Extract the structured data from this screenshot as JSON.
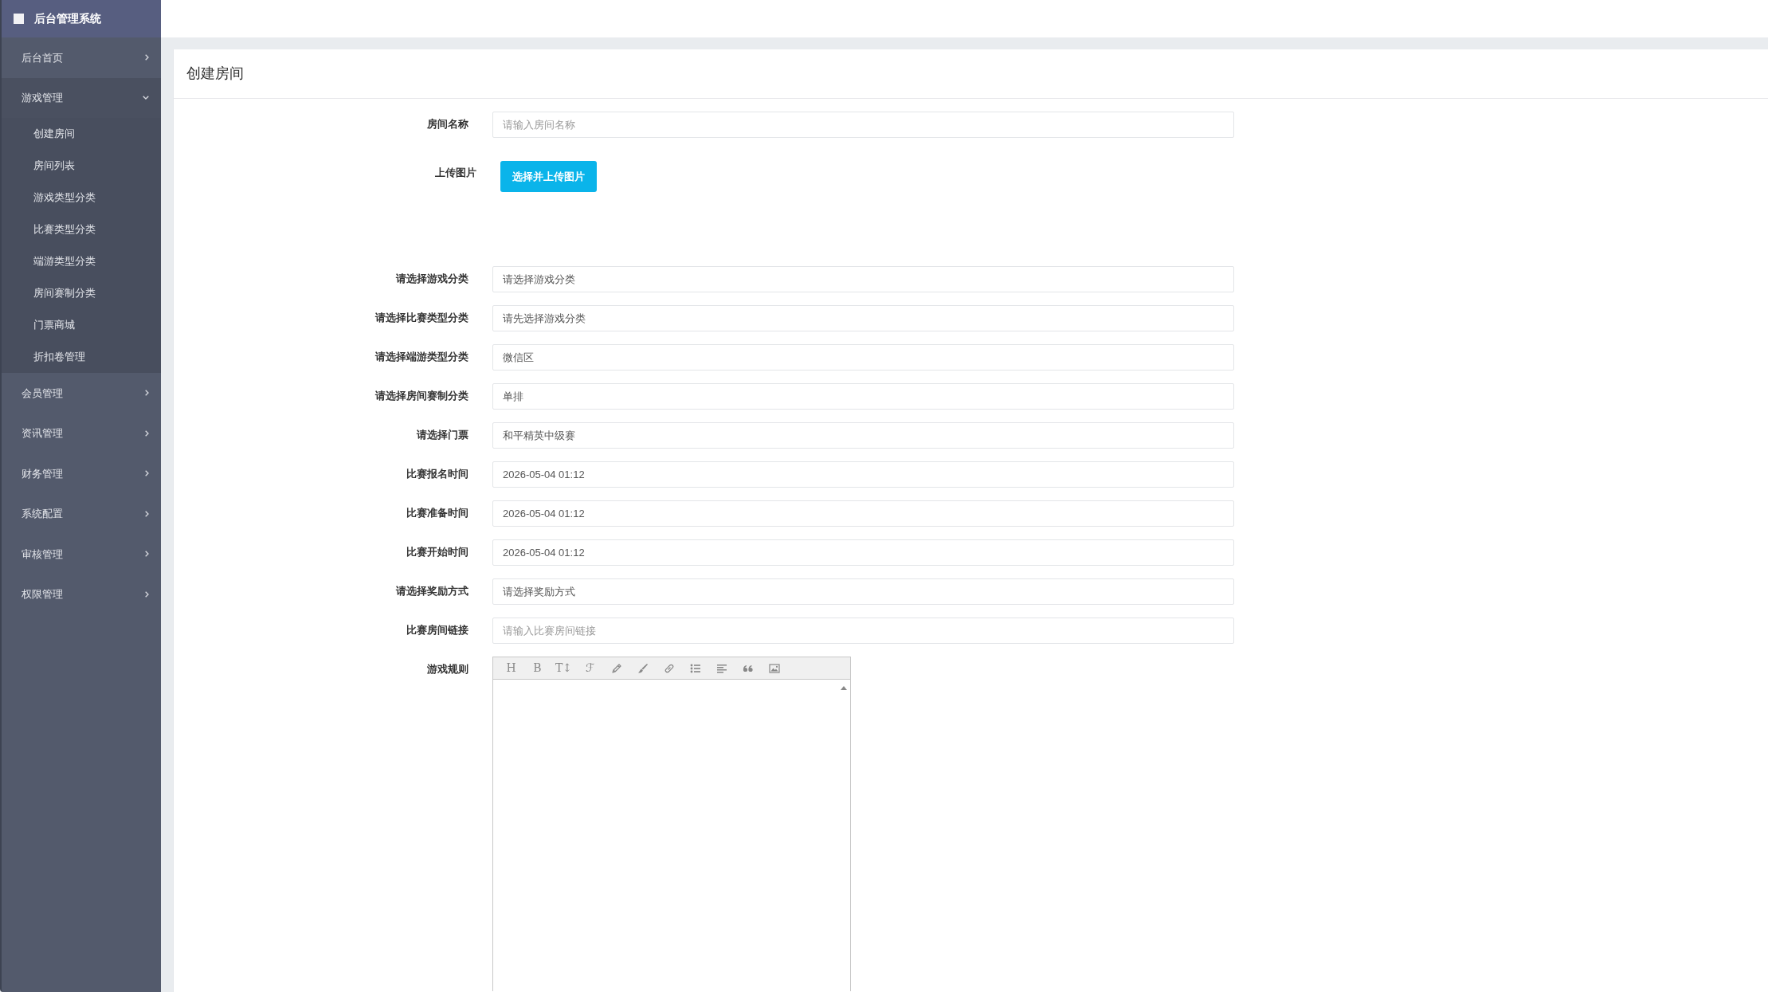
{
  "sidebar": {
    "title": "后台管理系统",
    "items": [
      {
        "label": "后台首页",
        "expanded": false
      },
      {
        "label": "游戏管理",
        "expanded": true,
        "children": [
          {
            "label": "创建房间"
          },
          {
            "label": "房间列表"
          },
          {
            "label": "游戏类型分类"
          },
          {
            "label": "比赛类型分类"
          },
          {
            "label": "端游类型分类"
          },
          {
            "label": "房间赛制分类"
          },
          {
            "label": "门票商城"
          },
          {
            "label": "折扣卷管理"
          }
        ]
      },
      {
        "label": "会员管理",
        "expanded": false
      },
      {
        "label": "资讯管理",
        "expanded": false
      },
      {
        "label": "财务管理",
        "expanded": false
      },
      {
        "label": "系统配置",
        "expanded": false
      },
      {
        "label": "审核管理",
        "expanded": false
      },
      {
        "label": "权限管理",
        "expanded": false
      }
    ]
  },
  "page": {
    "title": "创建房间"
  },
  "form": {
    "fields": [
      {
        "kind": "text",
        "label": "房间名称",
        "placeholder": "请输入房间名称"
      },
      {
        "kind": "upload",
        "label": "上传图片",
        "button": "选择并上传图片"
      },
      {
        "kind": "text",
        "label": "请选择游戏分类",
        "value": "请选择游戏分类"
      },
      {
        "kind": "text",
        "label": "请选择比赛类型分类",
        "value": "请先选择游戏分类"
      },
      {
        "kind": "text",
        "label": "请选择端游类型分类",
        "value": "微信区"
      },
      {
        "kind": "text",
        "label": "请选择房间赛制分类",
        "value": "单排"
      },
      {
        "kind": "text",
        "label": "请选择门票",
        "value": "和平精英中级赛"
      },
      {
        "kind": "text",
        "label": "比赛报名时间",
        "value": "2026-05-04 01:12"
      },
      {
        "kind": "text",
        "label": "比赛准备时间",
        "value": "2026-05-04 01:12"
      },
      {
        "kind": "text",
        "label": "比赛开始时间",
        "value": "2026-05-04 01:12"
      },
      {
        "kind": "text",
        "label": "请选择奖励方式",
        "value": "请选择奖励方式"
      },
      {
        "kind": "text",
        "label": "比赛房间链接",
        "placeholder": "请输入比赛房间链接"
      },
      {
        "kind": "editor",
        "label": "游戏规则",
        "toolbar": [
          {
            "kind": "text",
            "label": "H"
          },
          {
            "kind": "text",
            "label": "B"
          },
          {
            "kind": "text",
            "label": "T↕"
          },
          {
            "kind": "text",
            "label": "ℱ"
          },
          {
            "kind": "icon"
          },
          {
            "kind": "icon"
          },
          {
            "kind": "icon"
          },
          {
            "kind": "icon"
          },
          {
            "kind": "icon"
          },
          {
            "kind": "icon"
          },
          {
            "kind": "icon"
          }
        ]
      }
    ]
  }
}
